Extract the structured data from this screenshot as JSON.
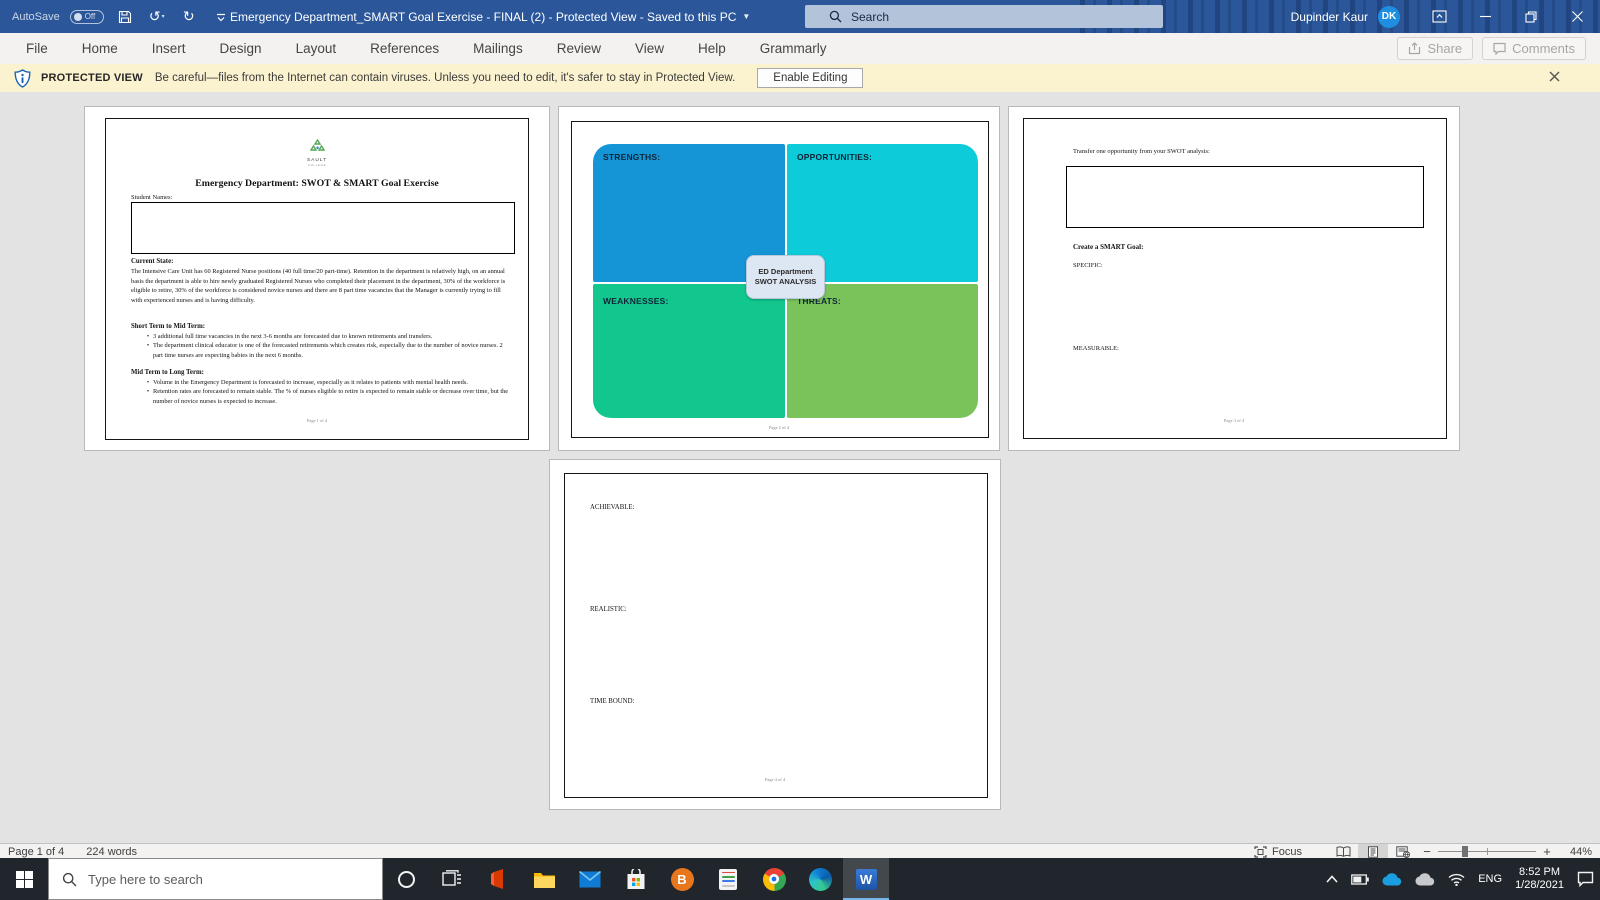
{
  "colors": {
    "titlebar": "#2b579a",
    "avatar": "#1e8fe0",
    "banner_bg": "#fbf3cf",
    "taskbar": "#20262c",
    "swot_strengths": "#1595d5",
    "swot_opportunities": "#0dcbd9",
    "swot_weaknesses": "#12c78e",
    "swot_threats": "#7ac35b",
    "swot_center_bg": "#dde6f3"
  },
  "titlebar": {
    "autosave_label": "AutoSave",
    "autosave_state": "Off",
    "window_title": "Emergency Department_SMART Goal Exercise - FINAL (2)  -  Protected View  -  Saved to this PC",
    "search_placeholder": "Search",
    "user_name": "Dupinder Kaur",
    "user_initials": "DK"
  },
  "ribbon": {
    "tabs": [
      "File",
      "Home",
      "Insert",
      "Design",
      "Layout",
      "References",
      "Mailings",
      "Review",
      "View",
      "Help",
      "Grammarly"
    ],
    "share_label": "Share",
    "comments_label": "Comments"
  },
  "banner": {
    "title": "PROTECTED VIEW",
    "message": "Be careful—files from the Internet can contain viruses. Unless you need to edit, it's safer to stay in Protected View.",
    "button_label": "Enable Editing"
  },
  "page1": {
    "logo_name": "SAULT",
    "logo_sub": "COLLEGE",
    "title": "Emergency Department: SWOT & SMART Goal Exercise",
    "student_names_label": "Student Names:",
    "current_state_heading": "Current State:",
    "current_state_text": "The Intensive Care Unit has 60 Registered Nurse positions (40 full time/20 part-time). Retention in the department is relatively high, on an annual basis the department is able to hire newly graduated Registered Nurses who completed their placement in the department, 30% of the workforce is eligible to retire, 30% of the workforce is considered novice nurses and there are 8 part time vacancies that the Manager is currently trying to fill with experienced nurses and is having difficulty.",
    "short_term_heading": "Short Term to Mid Term:",
    "short_term_bullets": [
      "3 additional full time vacancies in the next 3-6 months are forecasted due to known retirements and transfers.",
      "The department clinical educator is one of the forecasted retirements which creates risk, especially due to the number of novice nurses. 2 part time nurses are expecting babies in the next 6 months."
    ],
    "mid_term_heading": "Mid Term to Long Term:",
    "mid_term_bullets": [
      "Volume in the Emergency Department is forecasted to increase, especially as it relates to patients with mental health needs.",
      "Retention rates are forecasted to remain stable. The % of nurses eligible to retire is expected to remain stable or decrease over time, but the number of novice nurses is expected to increase."
    ],
    "footer": "Page 1 of 4"
  },
  "page2": {
    "strengths_label": "STRENGTHS:",
    "opportunities_label": "OPPORTUNITIES:",
    "weaknesses_label": "WEAKNESSES:",
    "threats_label": "THREATS:",
    "center_line1": "ED Department",
    "center_line2": "SWOT ANALYSIS",
    "footer": "Page 2 of 4"
  },
  "page3": {
    "transfer_label": "Transfer one opportunity from your SWOT analysis:",
    "smart_heading": "Create a SMART Goal:",
    "specific_label": "SPECIFIC:",
    "measurable_label": "MEASURABLE:",
    "footer": "Page 3 of 4"
  },
  "page4": {
    "achievable_label": "ACHIEVABLE:",
    "realistic_label": "REALISTIC:",
    "time_bound_label": "TIME BOUND:",
    "footer": "Page 4 of 4"
  },
  "statusbar": {
    "page_label": "Page 1 of 4",
    "words_label": "224 words",
    "focus_label": "Focus",
    "zoom_value": "44%"
  },
  "taskbar": {
    "search_placeholder": "Type here to search",
    "language": "ENG",
    "time": "8:52 PM",
    "date": "1/28/2021"
  }
}
